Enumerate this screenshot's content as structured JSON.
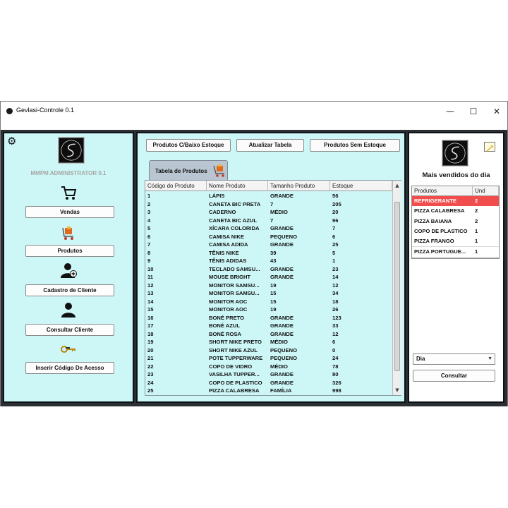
{
  "window": {
    "title": "Gevlasi-Controle 0.1",
    "minimize_glyph": "—",
    "maximize_glyph": "☐",
    "close_glyph": "✕"
  },
  "sidebar": {
    "admin_label": "MMPM ADMINISTRATOR 0.1",
    "buttons": [
      {
        "label": "Vendas",
        "icon": "shopping-cart-icon"
      },
      {
        "label": "Produtos",
        "icon": "products-cart-icon"
      },
      {
        "label": "Cadastro de Cliente",
        "icon": "add-user-icon"
      },
      {
        "label": "Consultar Cliente",
        "icon": "user-icon"
      },
      {
        "label": "Inserir Código De Acesso",
        "icon": "key-icon"
      }
    ]
  },
  "toolbar": {
    "low_stock_label": "Produtos C/Baixo Estoque",
    "refresh_label": "Atualizar Tabela",
    "no_stock_label": "Produtos Sem Estoque"
  },
  "tab": {
    "label": "Tabela de Produtos"
  },
  "products_table": {
    "columns": [
      "Código do Produto",
      "Nome Produto",
      "Tamanho Produto",
      "Estoque"
    ],
    "rows": [
      [
        "1",
        "LÁPIS",
        "GRANDE",
        "56"
      ],
      [
        "2",
        "CANETA BIC PRETA",
        "7",
        "205"
      ],
      [
        "3",
        "CADERNO",
        "MÉDIO",
        "20"
      ],
      [
        "4",
        "CANETA BIC AZUL",
        "7",
        "96"
      ],
      [
        "5",
        "XÍCARA COLORIDA",
        "GRANDE",
        "7"
      ],
      [
        "6",
        "CAMISA NIKE",
        "PEQUENO",
        "6"
      ],
      [
        "7",
        "CAMISA ADIDA",
        "GRANDE",
        "25"
      ],
      [
        "8",
        "TÊNIS NIKE",
        "39",
        "5"
      ],
      [
        "9",
        "TÊNIS ADIDAS",
        "43",
        "1"
      ],
      [
        "10",
        "TECLADO SAMSU...",
        "GRANDE",
        "23"
      ],
      [
        "11",
        "MOUSE BRIGHT",
        "GRANDE",
        "14"
      ],
      [
        "12",
        "MONITOR SAMSU...",
        "19",
        "12"
      ],
      [
        "13",
        "MONITOR SAMSU...",
        "15",
        "34"
      ],
      [
        "14",
        "MONITOR AOC",
        "15",
        "18"
      ],
      [
        "15",
        "MONITOR AOC",
        "19",
        "26"
      ],
      [
        "16",
        "BONÉ PRETO",
        "GRANDE",
        "123"
      ],
      [
        "17",
        "BONÉ AZUL",
        "GRANDE",
        "33"
      ],
      [
        "18",
        "BONÉ ROSA",
        "GRANDE",
        "12"
      ],
      [
        "19",
        "SHORT NIKE PRETO",
        "MÉDIO",
        "6"
      ],
      [
        "20",
        "SHORT NIKE AZUL",
        "PEQUENO",
        "0"
      ],
      [
        "21",
        "POTE TUPPERWARE",
        "PEQUENO",
        "24"
      ],
      [
        "22",
        "COPO DE VIDRO",
        "MÉDIO",
        "78"
      ],
      [
        "23",
        "VASILHA TUPPER...",
        "GRANDE",
        "80"
      ],
      [
        "24",
        "COPO DE PLASTICO",
        "GRANDE",
        "326"
      ],
      [
        "25",
        "PIZZA CALABRESA",
        "FAMÍLIA",
        "998"
      ]
    ]
  },
  "bestsellers": {
    "title": "Mais vendidos do dia",
    "columns": [
      "Produtos",
      "Und"
    ],
    "rows": [
      [
        "REFRIGERANTE",
        "2"
      ],
      [
        "PIZZA CALABRESA",
        "2"
      ],
      [
        "PIZZA BAIANA",
        "2"
      ],
      [
        "COPO DE PLASTICO",
        "1"
      ],
      [
        "PIZZA FRANGO",
        "1"
      ],
      [
        "PIZZA PORTUGUE...",
        "1"
      ]
    ],
    "selected_row": 0,
    "period_value": "Dia",
    "consult_label": "Consultar"
  },
  "colors": {
    "panel_bg": "#cdf7f7",
    "frame_dark": "#2b2f33",
    "selection_red": "#f24d4d"
  }
}
